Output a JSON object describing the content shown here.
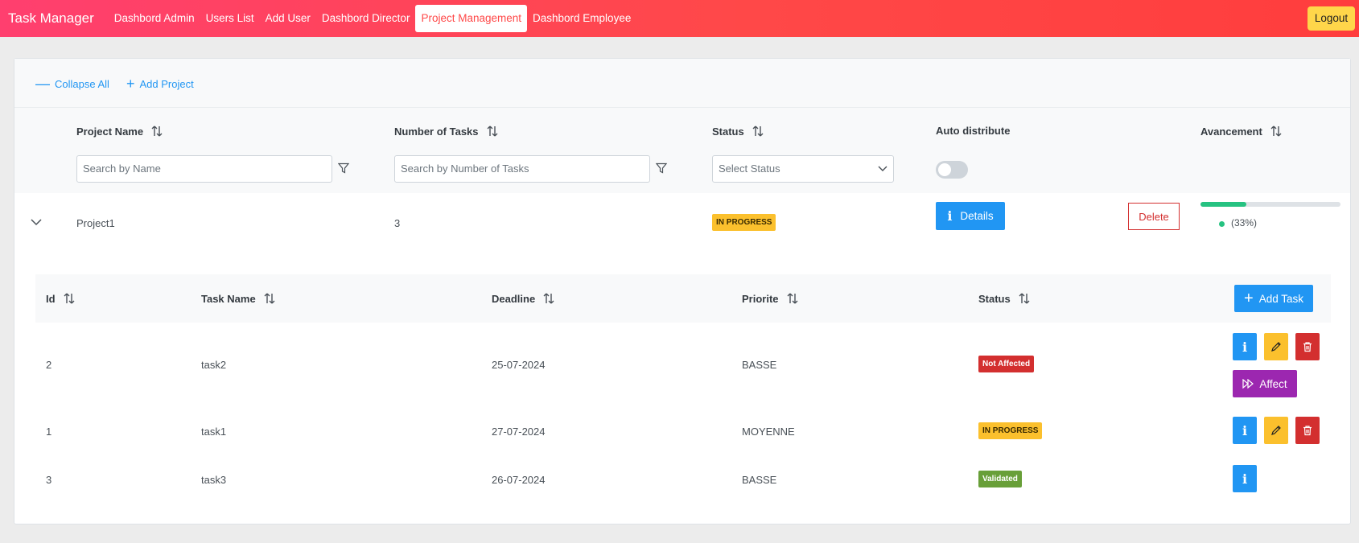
{
  "navbar": {
    "brand": "Task Manager",
    "links": [
      "Dashbord Admin",
      "Users List",
      "Add User",
      "Dashbord Director",
      "Project Management",
      "Dashbord Employee"
    ],
    "active_link": "Project Management",
    "logout_label": "Logout"
  },
  "toolbar": {
    "collapse_label": "Collapse All",
    "add_project_label": "Add Project"
  },
  "columns": {
    "project_name": "Project Name",
    "number_of_tasks": "Number of Tasks",
    "status": "Status",
    "auto_distribute": "Auto distribute",
    "avancement": "Avancement"
  },
  "filters": {
    "name_placeholder": "Search by Name",
    "tasks_placeholder": "Search by Number of Tasks",
    "status_placeholder": "Select Status",
    "auto_distribute_on": false
  },
  "project": {
    "name": "Project1",
    "task_count": "3",
    "status": "IN PROGRESS",
    "details_label": "Details",
    "delete_label": "Delete",
    "progress_fraction": 0.33,
    "progress_label": "(33%)"
  },
  "task_columns": {
    "id": "Id",
    "task_name": "Task Name",
    "deadline": "Deadline",
    "priorite": "Priorite",
    "status": "Status",
    "add_task_label": "Add Task"
  },
  "tasks": [
    {
      "id": "2",
      "name": "task2",
      "deadline": "25-07-2024",
      "priorite": "BASSE",
      "status": "Not Affected",
      "affect_label": "Affect"
    },
    {
      "id": "1",
      "name": "task1",
      "deadline": "27-07-2024",
      "priorite": "MOYENNE",
      "status": "IN PROGRESS"
    },
    {
      "id": "3",
      "name": "task3",
      "deadline": "26-07-2024",
      "priorite": "BASSE",
      "status": "Validated"
    }
  ],
  "colors": {
    "primary": "#2196f3",
    "danger": "#d32f2f",
    "warning": "#fbc02d",
    "success": "#689f38",
    "help": "#9c27b0",
    "progress": "#26c281"
  }
}
